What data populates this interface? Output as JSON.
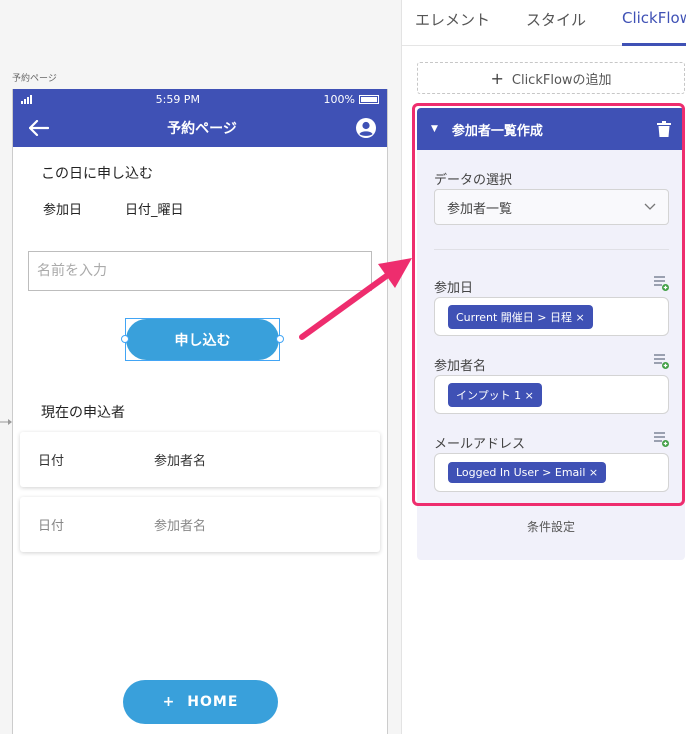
{
  "canvas": {
    "page_label": "予約ページ",
    "status_bar": {
      "time": "5:59 PM",
      "battery": "100%"
    },
    "app_bar": {
      "title": "予約ページ"
    },
    "apply_section_title": "この日に申し込む",
    "date_row": {
      "label": "参加日",
      "value": "日付_曜日"
    },
    "name_input": {
      "placeholder": "名前を入力"
    },
    "apply_button": "申し込む",
    "applicants_title": "現在の申込者",
    "list_header": {
      "date": "日付",
      "name": "参加者名"
    },
    "list_row": {
      "date": "日付",
      "name": "参加者名"
    },
    "home_button": {
      "plus": "+",
      "label": "HOME"
    }
  },
  "panel": {
    "tabs": [
      {
        "label": "エレメント"
      },
      {
        "label": "スタイル"
      },
      {
        "label": "ClickFlow"
      }
    ],
    "add_flow_label": "ClickFlowの追加",
    "flow": {
      "title": "参加者一覧作成",
      "data_select_label": "データの選択",
      "data_select_value": "参加者一覧",
      "fields": [
        {
          "label": "参加日",
          "chip": "Current 開催日 > 日程 ×"
        },
        {
          "label": "参加者名",
          "chip": "インプット 1 ×"
        },
        {
          "label": "メールアドレス",
          "chip": "Logged In User > Email ×"
        }
      ],
      "condition_label": "条件設定"
    }
  },
  "colors": {
    "primary": "#3f51b5",
    "button": "#39a0db",
    "highlight": "#ee2d6e"
  }
}
